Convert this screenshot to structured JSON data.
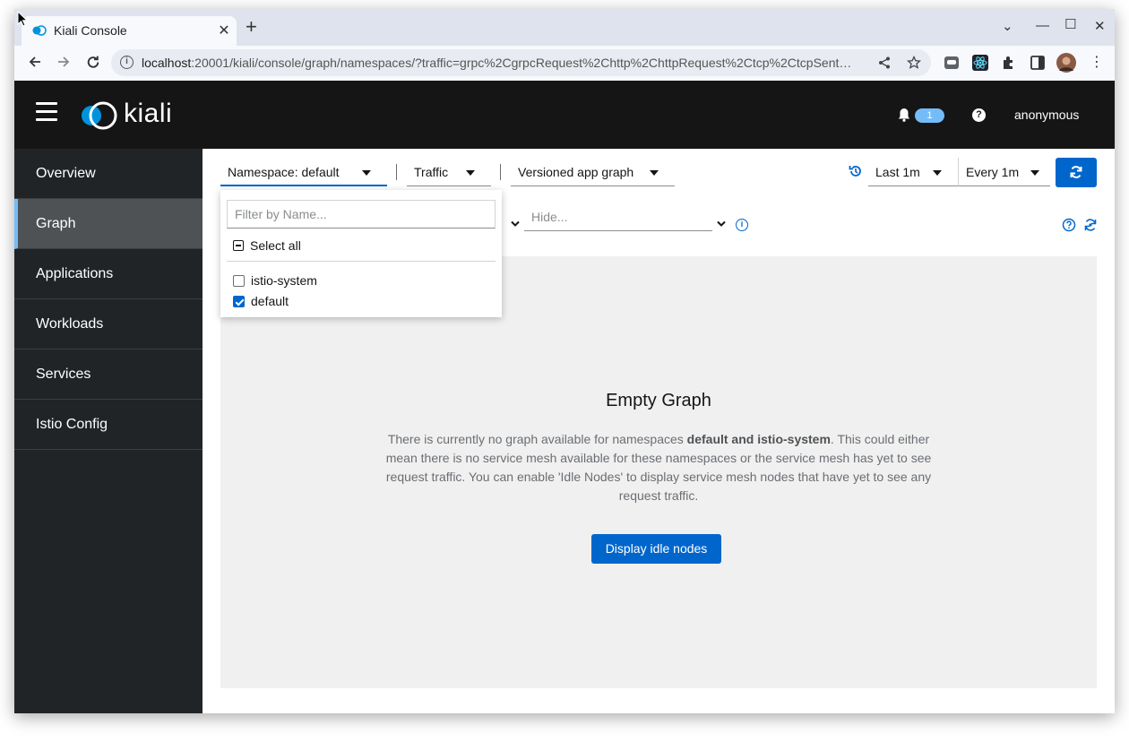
{
  "browser": {
    "tab_title": "Kiali Console",
    "tab_close": "✕",
    "new_tab": "+",
    "url_host": "localhost",
    "url_rest": ":20001/kiali/console/graph/namespaces/?traffic=grpc%2CgrpcRequest%2Chttp%2ChttpRequest%2Ctcp%2CtcpSent…",
    "window_controls": {
      "chevron": "⌄",
      "minimize": "—",
      "maximize": "☐",
      "close": "✕"
    }
  },
  "header": {
    "logo_text": "kiali",
    "notification_count": "1",
    "help": "?",
    "user": "anonymous"
  },
  "sidebar": {
    "items": [
      {
        "label": "Overview"
      },
      {
        "label": "Graph"
      },
      {
        "label": "Applications"
      },
      {
        "label": "Workloads"
      },
      {
        "label": "Services"
      },
      {
        "label": "Istio Config"
      }
    ]
  },
  "toolbar": {
    "namespace_label": "Namespace:  default",
    "traffic_label": "Traffic",
    "graph_type_label": "Versioned app graph",
    "duration_label": "Last 1m",
    "refresh_interval_label": "Every 1m",
    "hide_placeholder": "Hide..."
  },
  "namespace_dropdown": {
    "filter_placeholder": "Filter by Name...",
    "select_all_label": "Select all",
    "options": [
      {
        "label": "istio-system",
        "checked": false
      },
      {
        "label": "default",
        "checked": true
      }
    ]
  },
  "empty_graph": {
    "title": "Empty Graph",
    "body_prefix": "There is currently no graph available for namespaces ",
    "body_namespaces": "default and istio-system",
    "body_suffix": ". This could either mean there is no service mesh available for these namespaces or the service mesh has yet to see request traffic. You can enable 'Idle Nodes' to display service mesh nodes that have yet to see any request traffic.",
    "button_label": "Display idle nodes"
  },
  "colors": {
    "accent": "#0066cc",
    "header_bg": "#151515",
    "sidebar_bg": "#212427",
    "badge": "#73bcf7"
  }
}
